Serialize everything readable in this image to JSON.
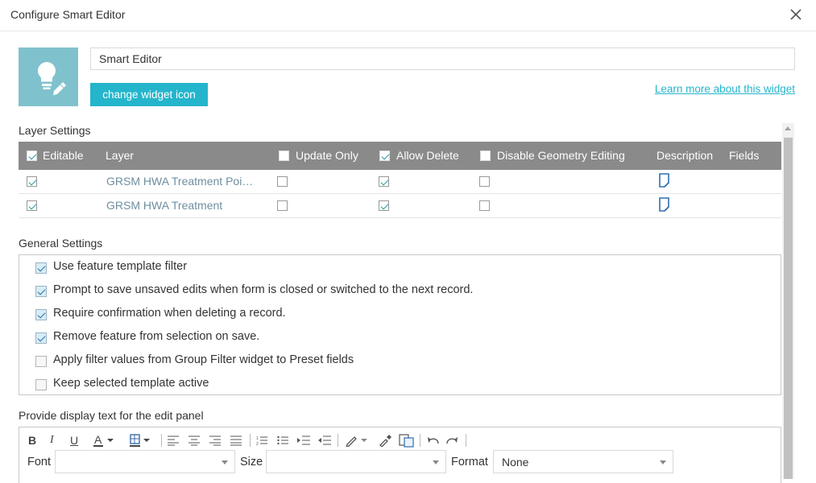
{
  "window": {
    "title": "Configure Smart Editor"
  },
  "widget": {
    "name_value": "Smart Editor",
    "change_icon_label": "change widget icon",
    "learn_more_label": "Learn more about this widget",
    "icon_name": "lightbulb-pencil-icon",
    "icon_bg": "#7fc2cd"
  },
  "layer_settings": {
    "section_label": "Layer Settings",
    "headers": {
      "editable": "Editable",
      "layer": "Layer",
      "update_only": "Update Only",
      "allow_delete": "Allow Delete",
      "disable_geometry": "Disable Geometry Editing",
      "description": "Description",
      "fields": "Fields"
    },
    "header_checks": {
      "editable": true,
      "update_only": false,
      "allow_delete": true,
      "disable_geometry": false
    },
    "rows": [
      {
        "editable": true,
        "layer": "GRSM HWA Treatment Poi…",
        "update_only": false,
        "allow_delete": true,
        "disable_geometry": false
      },
      {
        "editable": true,
        "layer": "GRSM HWA Treatment",
        "update_only": false,
        "allow_delete": true,
        "disable_geometry": false
      }
    ]
  },
  "general_settings": {
    "section_label": "General Settings",
    "items": [
      {
        "label": "Use feature template filter",
        "checked": true
      },
      {
        "label": "Prompt to save unsaved edits when form is closed or switched to the next record.",
        "checked": true
      },
      {
        "label": "Require confirmation when deleting a record.",
        "checked": true
      },
      {
        "label": "Remove feature from selection on save.",
        "checked": true
      },
      {
        "label": "Apply filter values from Group Filter widget to Preset fields",
        "checked": false
      },
      {
        "label": "Keep selected template active",
        "checked": false
      }
    ]
  },
  "edit_panel": {
    "section_label": "Provide display text for the edit panel",
    "toolbar": {
      "bold": "B",
      "italic": "I",
      "underline": "U",
      "font_label": "Font",
      "font_value": "",
      "size_label": "Size",
      "size_value": "",
      "format_label": "Format",
      "format_value": "None"
    }
  },
  "colors": {
    "accent": "#24b5cc",
    "header_bg": "#8a8a8a",
    "link_text": "#6e8fa0"
  }
}
